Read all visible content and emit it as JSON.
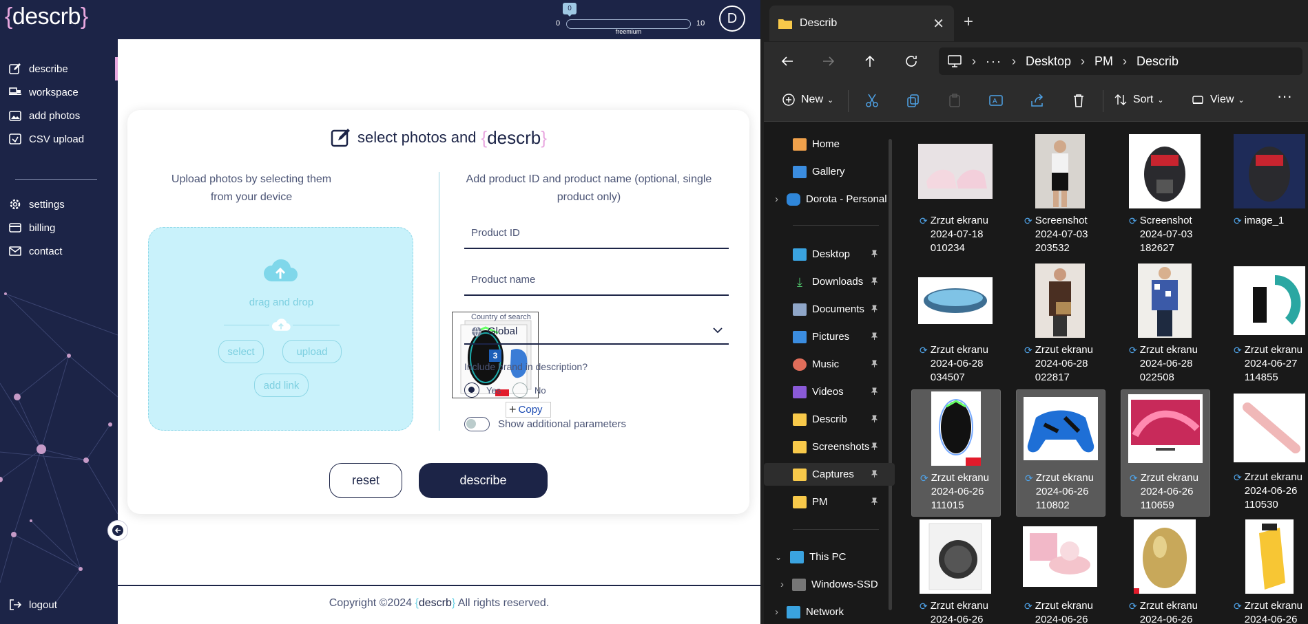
{
  "app": {
    "logo": {
      "open": "{",
      "name": "descrb",
      "close": "}"
    },
    "credits": {
      "current": "0",
      "min": "0",
      "max": "10",
      "plan": "freemium"
    },
    "avatar": "D",
    "nav": [
      {
        "label": "describe",
        "icon": "edit-icon"
      },
      {
        "label": "workspace",
        "icon": "workspace-icon"
      },
      {
        "label": "add photos",
        "icon": "image-icon"
      },
      {
        "label": "CSV upload",
        "icon": "csv-icon"
      },
      {
        "label": "settings",
        "icon": "gear-icon"
      },
      {
        "label": "billing",
        "icon": "billing-icon"
      },
      {
        "label": "contact",
        "icon": "mail-icon"
      },
      {
        "label": "logout",
        "icon": "logout-icon"
      }
    ],
    "card": {
      "title": "select photos and",
      "brand": "descrb",
      "upload_text": "Upload photos by selecting them from your device",
      "dropzone": {
        "text": "drag and drop",
        "select": "select",
        "upload": "upload",
        "add_link": "add link",
        "drag_count": "3",
        "copy": "Copy"
      },
      "right_title": "Add product ID and product name (optional, single product only)",
      "product_id_placeholder": "Product ID",
      "product_name_placeholder": "Product name",
      "country_label": "Country of search",
      "country_value": "Global",
      "brand_question": "Include brand in description?",
      "yes": "Yes",
      "no": "No",
      "show_params": "Show additional parameters",
      "reset": "reset",
      "describe": "describe"
    },
    "footer": {
      "pre": "Copyright ©2024",
      "brand": "descrb",
      "post": "All rights reserved."
    }
  },
  "explorer": {
    "tab_title": "Describ",
    "path": [
      "Desktop",
      "PM",
      "Describ"
    ],
    "commands": {
      "new": "New",
      "sort": "Sort",
      "view": "View"
    },
    "nav_items": [
      {
        "label": "Home"
      },
      {
        "label": "Gallery"
      },
      {
        "label": "Dorota - Personal"
      },
      {
        "label": "Desktop"
      },
      {
        "label": "Downloads"
      },
      {
        "label": "Documents"
      },
      {
        "label": "Pictures"
      },
      {
        "label": "Music"
      },
      {
        "label": "Videos"
      },
      {
        "label": "Describ"
      },
      {
        "label": "Screenshots"
      },
      {
        "label": "Captures"
      },
      {
        "label": "PM"
      },
      {
        "label": "This PC"
      },
      {
        "label": "Windows-SSD"
      },
      {
        "label": "Network"
      }
    ],
    "files": [
      {
        "name": "Zrzut ekranu\n2024-07-18\n010234"
      },
      {
        "name": "Screenshot\n2024-07-03\n203532"
      },
      {
        "name": "Screenshot\n2024-07-03\n182627"
      },
      {
        "name": "image_1"
      },
      {
        "name": "Zrzut ekranu\n2024-06-28\n034507"
      },
      {
        "name": "Zrzut ekranu\n2024-06-28\n022817"
      },
      {
        "name": "Zrzut ekranu\n2024-06-28\n022508"
      },
      {
        "name": "Zrzut ekranu\n2024-06-27\n114855"
      },
      {
        "name": "Zrzut ekranu\n2024-06-26\n111015"
      },
      {
        "name": "Zrzut ekranu\n2024-06-26\n110802"
      },
      {
        "name": "Zrzut ekranu\n2024-06-26\n110659"
      },
      {
        "name": "Zrzut ekranu\n2024-06-26\n110530"
      },
      {
        "name": "Zrzut ekranu\n2024-06-26"
      },
      {
        "name": "Zrzut ekranu\n2024-06-26"
      },
      {
        "name": "Zrzut ekranu\n2024-06-26"
      },
      {
        "name": "Zrzut ekranu\n2024-06-26"
      }
    ]
  }
}
